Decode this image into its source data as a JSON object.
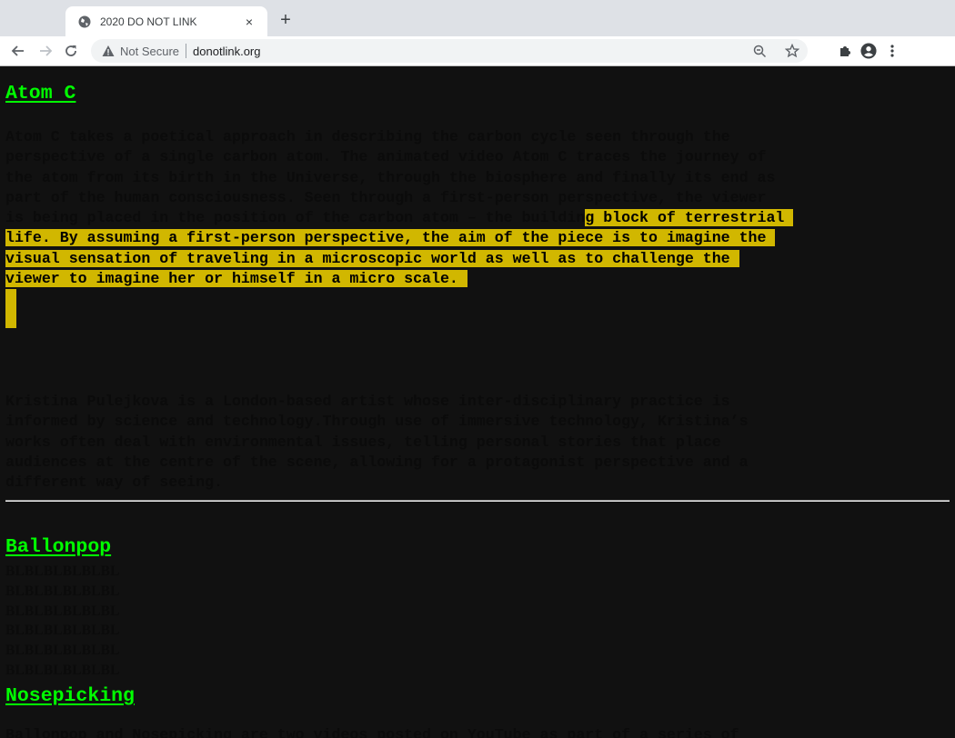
{
  "browser": {
    "tab": {
      "title": "2020 DO NOT LINK",
      "favicon": "globe-icon",
      "close_glyph": "×"
    },
    "new_tab_glyph": "+",
    "nav": {
      "back": "arrow-left-icon",
      "forward": "arrow-right-icon",
      "reload": "reload-icon"
    },
    "omnibox": {
      "security_label": "Not Secure",
      "security_icon": "warning-triangle-icon",
      "url": "donotlink.org",
      "zoom_icon": "zoom-out-icon",
      "bookmark_icon": "star-icon"
    },
    "extensions_icon": "puzzle-icon",
    "profile_icon": "account-icon",
    "menu_icon": "kebab-menu-icon"
  },
  "colors": {
    "page_bg": "#111111",
    "link": "#00ff00",
    "body_text": "#0b0b0b",
    "selection": "#d1b700"
  },
  "works": [
    {
      "title": "Atom C",
      "description_unselected": "Atom C takes a poetical approach in describing the carbon cycle seen through the\nperspective of a single carbon atom. The animated video Atom C traces the journey of\nthe atom from its birth in the Universe, through the biosphere and finally its end as\npart of the human consciousness. Seen through a first-person perspective, the viewer\nis being placed in the position of the carbon atom – the buildin",
      "description_selected": "g block of terrestrial \nlife. By assuming a first-person perspective, the aim of the piece is to imagine the \nvisual sensation of traveling in a microscopic world as well as to challenge the \nviewer to imagine her or himself in a micro scale. ",
      "bio": "Kristina Pulejkova is a London-based artist whose inter-disciplinary practice is\ninformed by science and technology.Through use of immersive technology, Kristina’s\nworks often deal with environmental issues, telling personal stories that place\naudiences at the centre of the scene, allowing for a protagonist perspective and a\ndifferent way of seeing."
    },
    {
      "title": "Ballonpop",
      "lines": [
        "BLBLBLBLBLBL",
        "BLBLBLBLBLBL",
        "BLBLBLBLBLBL",
        "BLBLBLBLBLBL",
        "BLBLBLBLBLBL",
        "BLBLBLBLBLBL"
      ]
    },
    {
      "title": "Nosepicking",
      "description": "Ballonpop and Nosepicking are two videos posted on YouTube as part of a series of"
    }
  ]
}
